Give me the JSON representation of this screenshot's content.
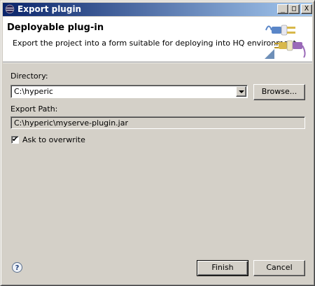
{
  "window": {
    "title": "Export plugin",
    "buttons": {
      "minimize": "_",
      "maximize": "□",
      "close": "X"
    }
  },
  "banner": {
    "title": "Deployable plug-in",
    "description": "Export the project into a form suitable for deploying into HQ environment",
    "image": "plugin-plugs-icon"
  },
  "form": {
    "directory_label": "Directory:",
    "directory_value": "C:\\hyperic",
    "browse_label": "Browse...",
    "export_path_label": "Export Path:",
    "export_path_value": "C:\\hyperic\\myserve-plugin.jar",
    "overwrite_label": "Ask to overwrite",
    "overwrite_checked": true
  },
  "footer": {
    "help_icon": "help-icon",
    "finish_label": "Finish",
    "cancel_label": "Cancel"
  },
  "colors": {
    "titlebar_start": "#0a246a",
    "titlebar_end": "#a6caf0",
    "dialog_bg": "#d4d0c8"
  }
}
